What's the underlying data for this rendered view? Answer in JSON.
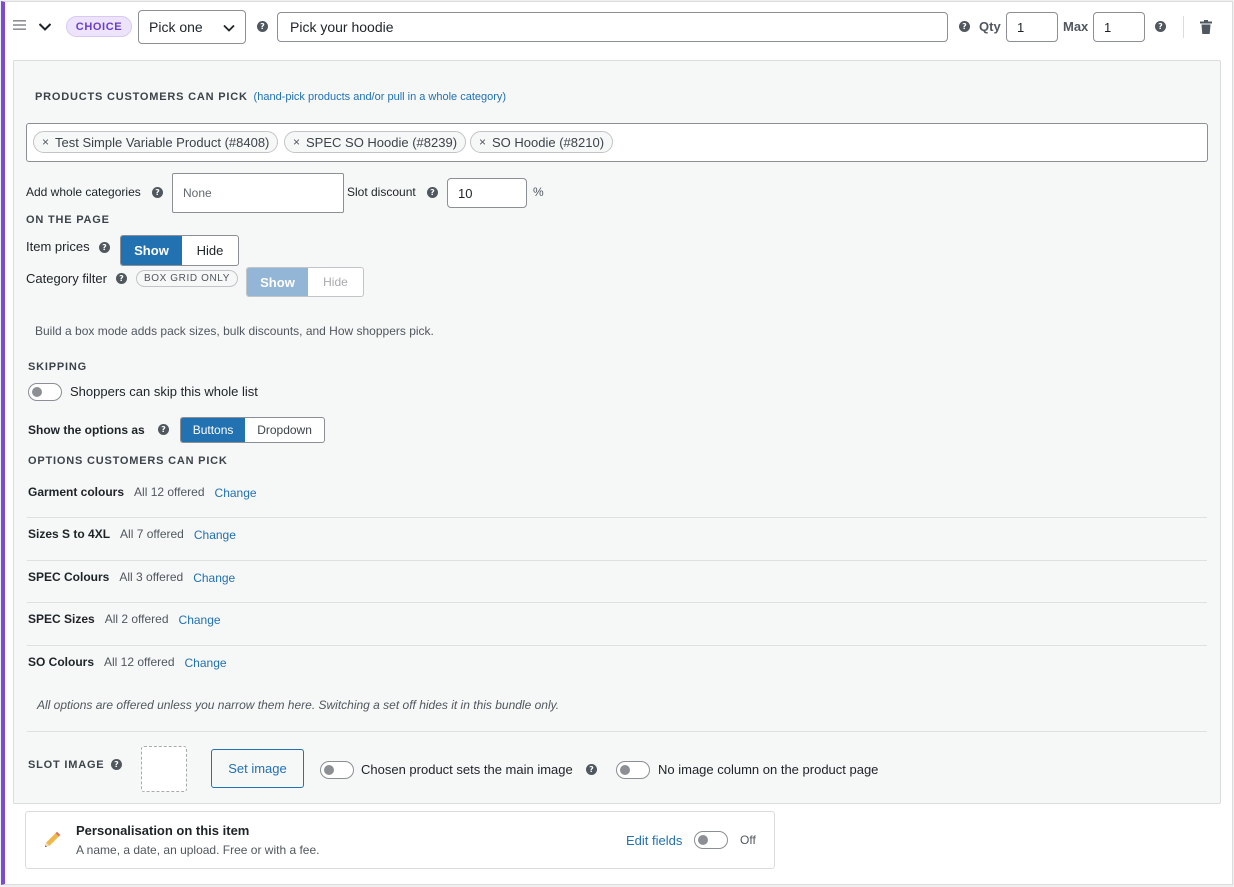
{
  "header": {
    "badge": "CHOICE",
    "mode_select": "Pick one",
    "slot_title": "Pick your hoodie",
    "qty_label": "Qty",
    "qty_value": "1",
    "max_label": "Max",
    "max_value": "1"
  },
  "products": {
    "heading": "PRODUCTS CUSTOMERS CAN PICK",
    "hint": "(hand-pick products and/or pull in a whole category)",
    "tags": [
      "Test Simple Variable Product (#8408)",
      "SPEC SO Hoodie (#8239)",
      "SO Hoodie (#8210)"
    ]
  },
  "categories": {
    "label": "Add whole categories",
    "placeholder": "None"
  },
  "discount": {
    "label": "Slot discount",
    "value": "10",
    "unit": "%"
  },
  "on_page": {
    "heading": "ON THE PAGE",
    "item_prices_label": "Item prices",
    "item_prices_show": "Show",
    "item_prices_hide": "Hide",
    "category_filter_label": "Category filter",
    "category_filter_badge": "BOX GRID ONLY",
    "category_filter_show": "Show",
    "category_filter_hide": "Hide",
    "note": "Build a box mode adds pack sizes, bulk discounts, and How shoppers pick."
  },
  "skipping": {
    "heading": "SKIPPING",
    "toggle_label": "Shoppers can skip this whole list"
  },
  "display": {
    "label": "Show the options as",
    "buttons": "Buttons",
    "dropdown": "Dropdown"
  },
  "options": {
    "heading": "OPTIONS CUSTOMERS CAN PICK",
    "change_label": "Change",
    "rows": [
      {
        "name": "Garment colours",
        "count": "All 12 offered"
      },
      {
        "name": "Sizes S to 4XL",
        "count": "All 7 offered"
      },
      {
        "name": "SPEC Colours",
        "count": "All 3 offered"
      },
      {
        "name": "SPEC Sizes",
        "count": "All 2 offered"
      },
      {
        "name": "SO Colours",
        "count": "All 12 offered"
      }
    ],
    "footnote": "All options are offered unless you narrow them here. Switching a set off hides it in this bundle only."
  },
  "slot_image": {
    "heading": "SLOT IMAGE",
    "button": "Set image",
    "toggle1": "Chosen product sets the main image",
    "toggle2": "No image column on the product page"
  },
  "personalisation": {
    "title": "Personalisation on this item",
    "desc": "A name, a date, an upload. Free or with a fee.",
    "edit": "Edit fields",
    "state": "Off"
  },
  "colors": {
    "accent": "#7b4ad8",
    "primary": "#2271b1"
  }
}
